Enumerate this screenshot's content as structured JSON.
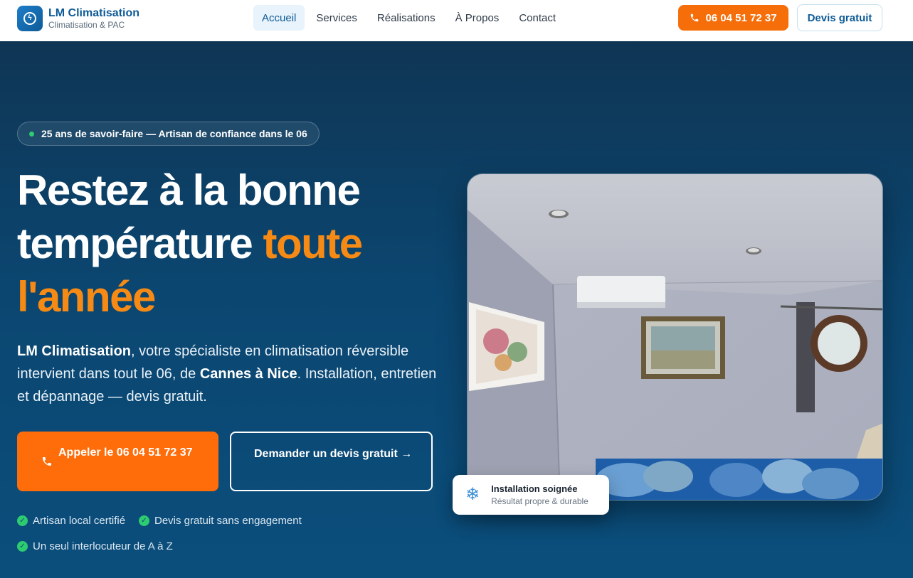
{
  "brand": {
    "name": "LM Climatisation",
    "tagline": "Climatisation & PAC"
  },
  "nav": [
    {
      "label": "Accueil",
      "active": true
    },
    {
      "label": "Services",
      "active": false
    },
    {
      "label": "Réalisations",
      "active": false
    },
    {
      "label": "À Propos",
      "active": false
    },
    {
      "label": "Contact",
      "active": false
    }
  ],
  "header": {
    "phone_label": "06 04 51 72 37",
    "quote_label": "Devis gratuit"
  },
  "hero": {
    "badge": "25 ans de savoir-faire — Artisan de confiance dans le 06",
    "headline_part1": "Restez à la bonne température ",
    "headline_accent": "toute l'année",
    "intro_brand": "LM Climatisation",
    "intro_text1": ", votre spécialiste en climatisation réversible intervient dans tout le 06, de ",
    "intro_cities": "Cannes à Nice",
    "intro_text2": ". Installation, entretien et dépannage — devis gratuit.",
    "cta_call_label": "Appeler le 06 04 51 72 37",
    "cta_quote_label": "Demander un devis gratuit →",
    "checks": [
      "Artisan local certifié",
      "Devis gratuit sans engagement",
      "Un seul interlocuteur de A à Z"
    ]
  },
  "card": {
    "title": "Installation soignée",
    "subtitle": "Résultat propre & durable"
  },
  "colors": {
    "primary": "#0d5a97",
    "accent": "#ff6d0a",
    "check": "#2ecc71",
    "hero_bg": "#0b4670"
  },
  "icons": {
    "logo": "lightning-icon",
    "phone": "phone-icon",
    "check": "check-circle-icon",
    "snow": "snowflake-icon"
  }
}
